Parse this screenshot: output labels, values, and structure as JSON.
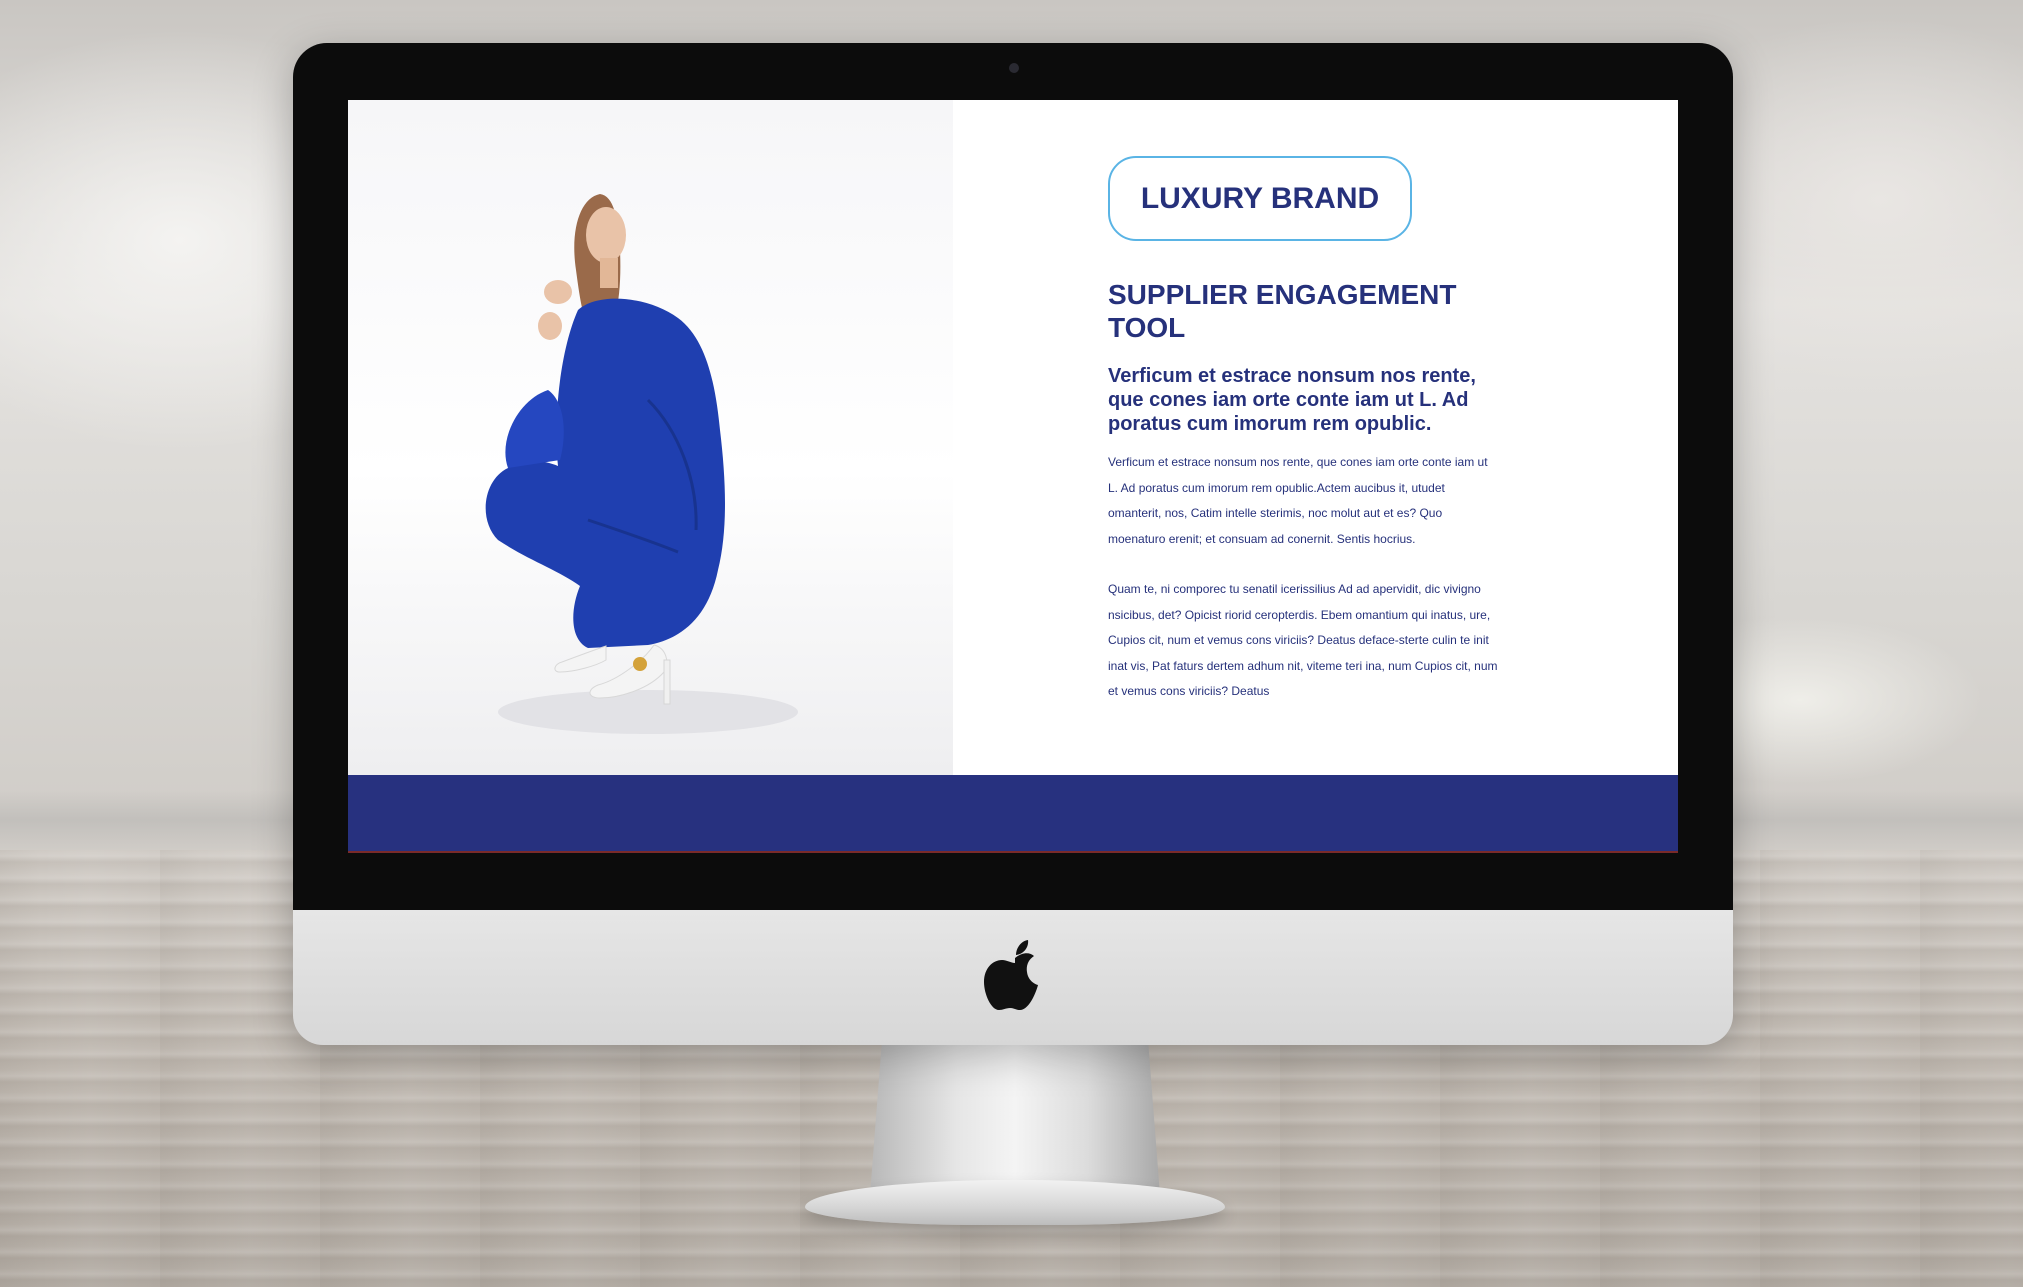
{
  "screen": {
    "brand_label": "LUXURY BRAND",
    "title": "SUPPLIER ENGAGEMENT TOOL",
    "lead": "Verficum et estrace nonsum nos rente, que cones iam orte conte iam ut L. Ad poratus cum imorum rem opublic.",
    "paragraphs": [
      "Verficum et estrace nonsum nos rente, que cones iam orte conte iam ut L. Ad poratus cum imorum rem opublic.Actem aucibus it, utudet omanterit, nos, Catim intelle sterimis, noc molut aut et es? Quo moenaturo erenit; et consuam ad conernit. Sentis hocrius.",
      "Quam te, ni comporec tu senatil icerissilius Ad ad apervidit, dic vivigno nsicibus, det? Opicist riorid ceropterdis. Ebem omantium qui inatus, ure, Cupios cit, num et vemus cons viriciis? Deatus deface-sterte culin te init inat vis, Pat faturs dertem adhum nit, viteme teri ina, num Cupios cit, num et vemus cons viriciis? Deatus"
    ]
  },
  "colors": {
    "brand_navy": "#26317b",
    "pill_border": "#5ab4e5",
    "footer_band": "#27317f",
    "outfit_blue": "#1f3fb0"
  },
  "icons": {
    "logo": "apple-logo",
    "camera": "webcam"
  }
}
